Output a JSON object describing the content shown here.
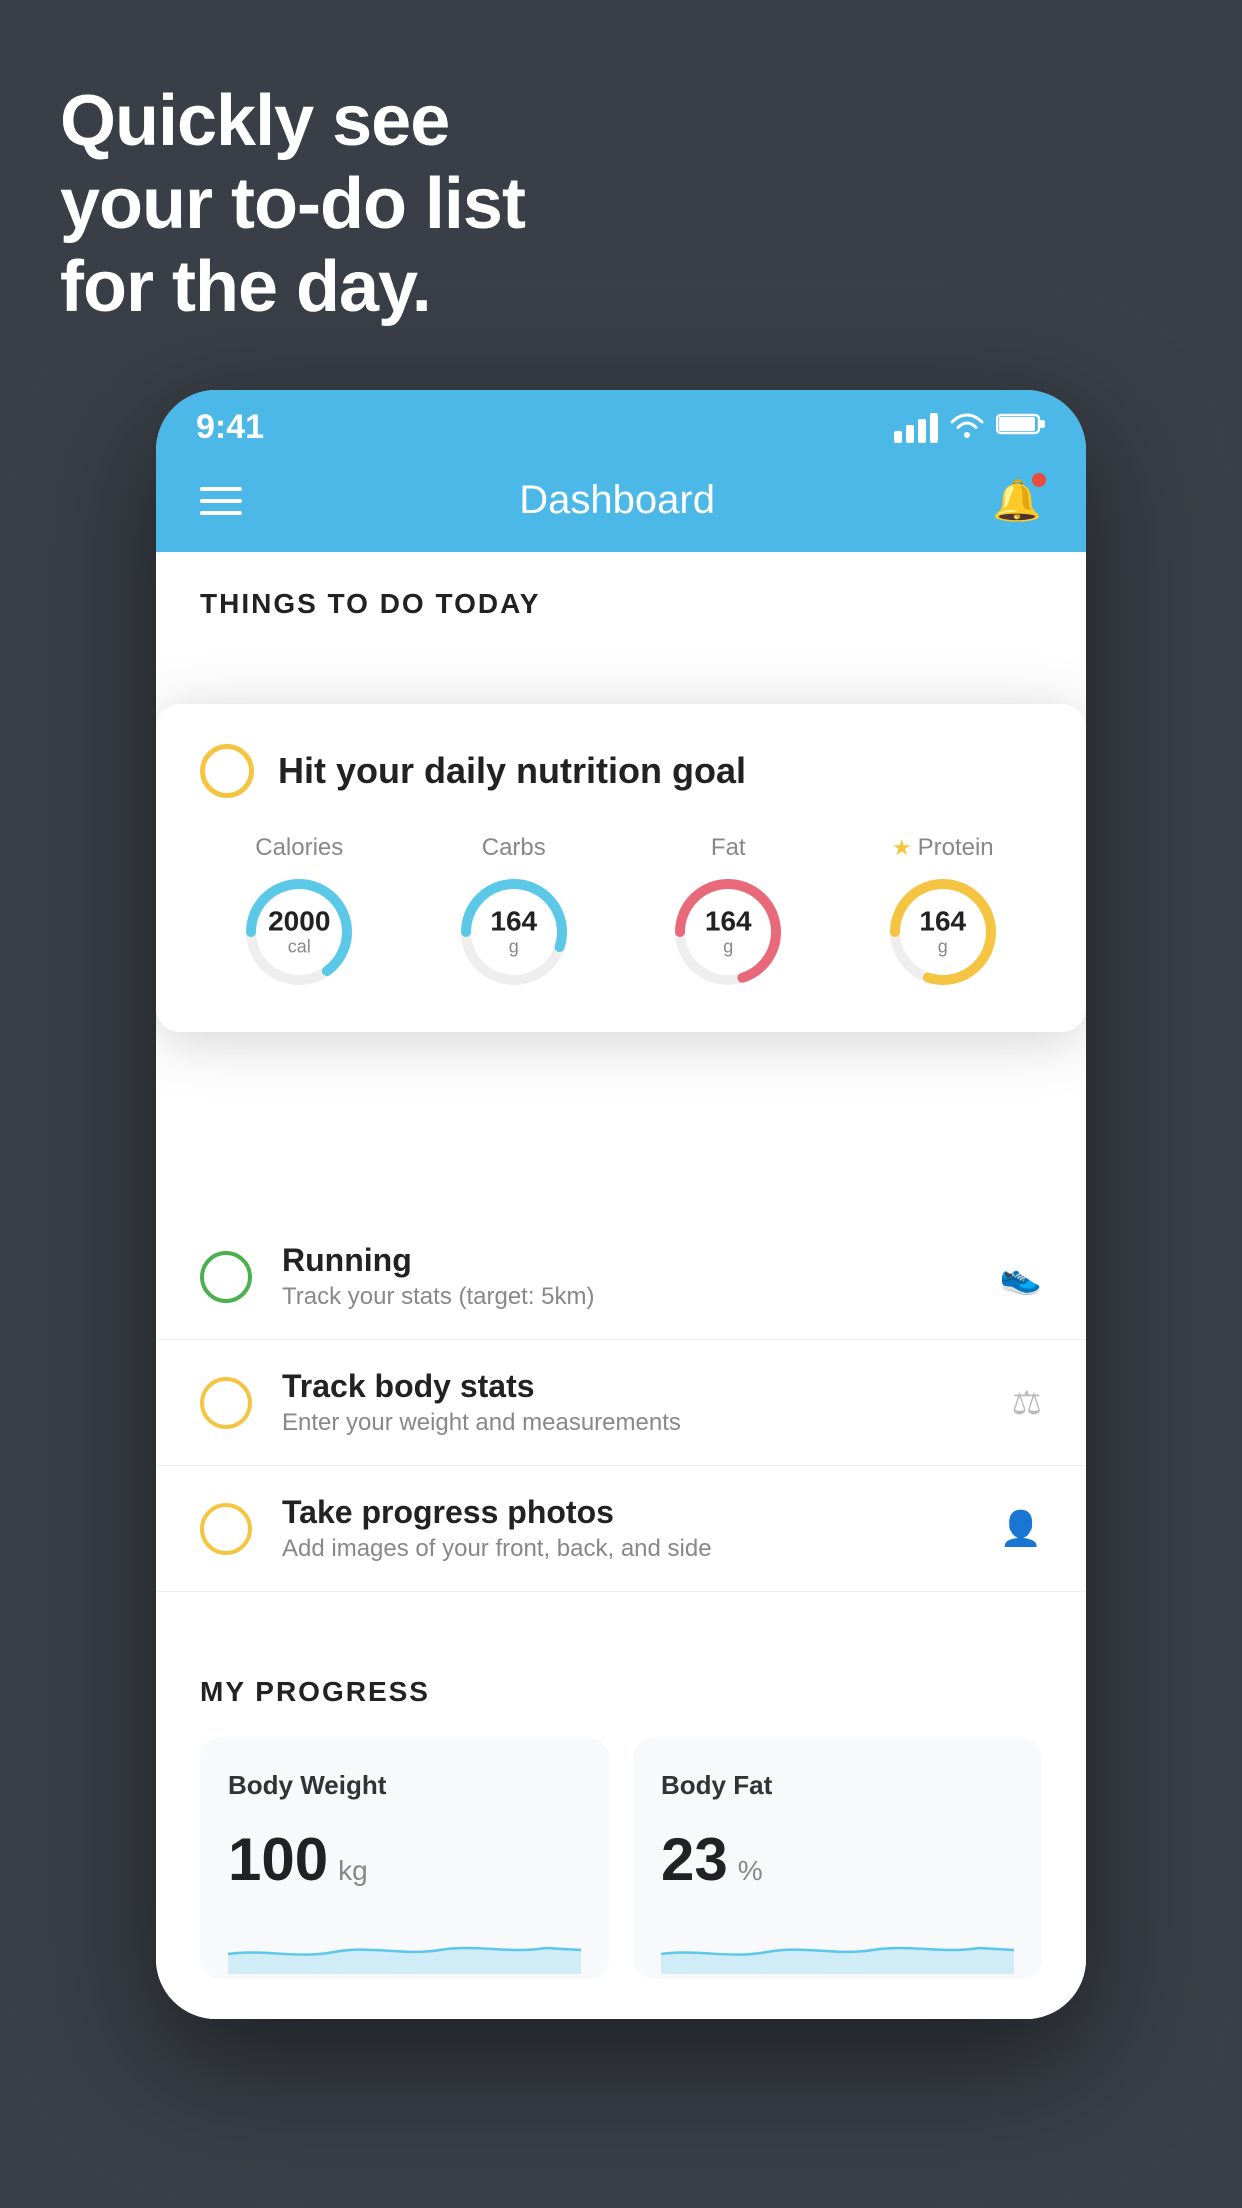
{
  "hero": {
    "line1": "Quickly see",
    "line2": "your to-do list",
    "line3": "for the day."
  },
  "statusBar": {
    "time": "9:41",
    "signalBars": [
      12,
      18,
      24,
      30
    ],
    "wifiSymbol": "wifi",
    "batterySymbol": "battery"
  },
  "navBar": {
    "title": "Dashboard"
  },
  "thingsToDo": {
    "sectionTitle": "THINGS TO DO TODAY"
  },
  "nutritionCard": {
    "circleStatus": "incomplete",
    "title": "Hit your daily nutrition goal",
    "items": [
      {
        "label": "Calories",
        "value": "2000",
        "unit": "cal",
        "color": "#5bc8e8",
        "percent": 65,
        "hasStar": false
      },
      {
        "label": "Carbs",
        "value": "164",
        "unit": "g",
        "color": "#5bc8e8",
        "percent": 55,
        "hasStar": false
      },
      {
        "label": "Fat",
        "value": "164",
        "unit": "g",
        "color": "#e86a7a",
        "percent": 70,
        "hasStar": false
      },
      {
        "label": "Protein",
        "value": "164",
        "unit": "g",
        "color": "#f5c542",
        "percent": 80,
        "hasStar": true
      }
    ]
  },
  "listItems": [
    {
      "circleColor": "green",
      "title": "Running",
      "subtitle": "Track your stats (target: 5km)",
      "icon": "👟"
    },
    {
      "circleColor": "yellow",
      "title": "Track body stats",
      "subtitle": "Enter your weight and measurements",
      "icon": "⚖"
    },
    {
      "circleColor": "yellow",
      "title": "Take progress photos",
      "subtitle": "Add images of your front, back, and side",
      "icon": "👤"
    }
  ],
  "progressSection": {
    "title": "MY PROGRESS",
    "cards": [
      {
        "title": "Body Weight",
        "value": "100",
        "unit": "kg",
        "chartColor": "#5bc8e8"
      },
      {
        "title": "Body Fat",
        "value": "23",
        "unit": "%",
        "chartColor": "#5bc8e8"
      }
    ]
  }
}
